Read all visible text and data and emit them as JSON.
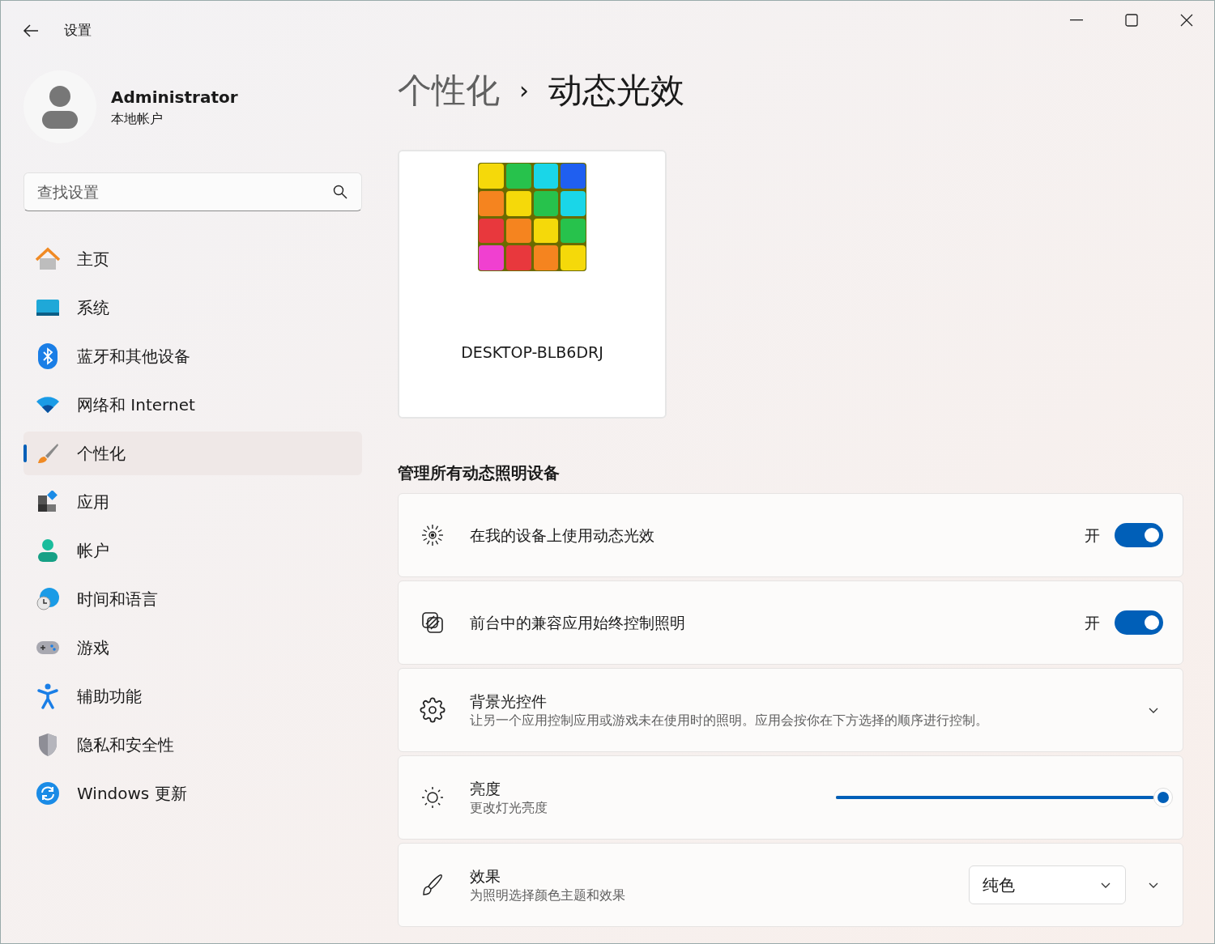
{
  "window": {
    "title": "设置"
  },
  "user": {
    "name": "Administrator",
    "account_type": "本地帐户"
  },
  "search": {
    "placeholder": "查找设置"
  },
  "sidebar": {
    "items": [
      {
        "label": "主页",
        "selected": false
      },
      {
        "label": "系统",
        "selected": false
      },
      {
        "label": "蓝牙和其他设备",
        "selected": false
      },
      {
        "label": "网络和 Internet",
        "selected": false
      },
      {
        "label": "个性化",
        "selected": true
      },
      {
        "label": "应用",
        "selected": false
      },
      {
        "label": "帐户",
        "selected": false
      },
      {
        "label": "时间和语言",
        "selected": false
      },
      {
        "label": "游戏",
        "selected": false
      },
      {
        "label": "辅助功能",
        "selected": false
      },
      {
        "label": "隐私和安全性",
        "selected": false
      },
      {
        "label": "Windows 更新",
        "selected": false
      }
    ]
  },
  "breadcrumb": {
    "parent": "个性化",
    "separator": "›",
    "current": "动态光效"
  },
  "device": {
    "name": "DESKTOP-BLB6DRJ"
  },
  "section_title": "管理所有动态照明设备",
  "settings": [
    {
      "kind": "toggle",
      "title": "在我的设备上使用动态光效",
      "state_label": "开",
      "on": true
    },
    {
      "kind": "toggle",
      "title": "前台中的兼容应用始终控制照明",
      "state_label": "开",
      "on": true
    },
    {
      "kind": "expander",
      "title": "背景光控件",
      "description": "让另一个应用控制应用或游戏未在使用时的照明。应用会按你在下方选择的顺序进行控制。"
    },
    {
      "kind": "slider",
      "title": "亮度",
      "description": "更改灯光亮度",
      "level": 0.98
    },
    {
      "kind": "dropdown",
      "title": "效果",
      "description": "为照明选择颜色主题和效果",
      "value": "纯色"
    }
  ]
}
